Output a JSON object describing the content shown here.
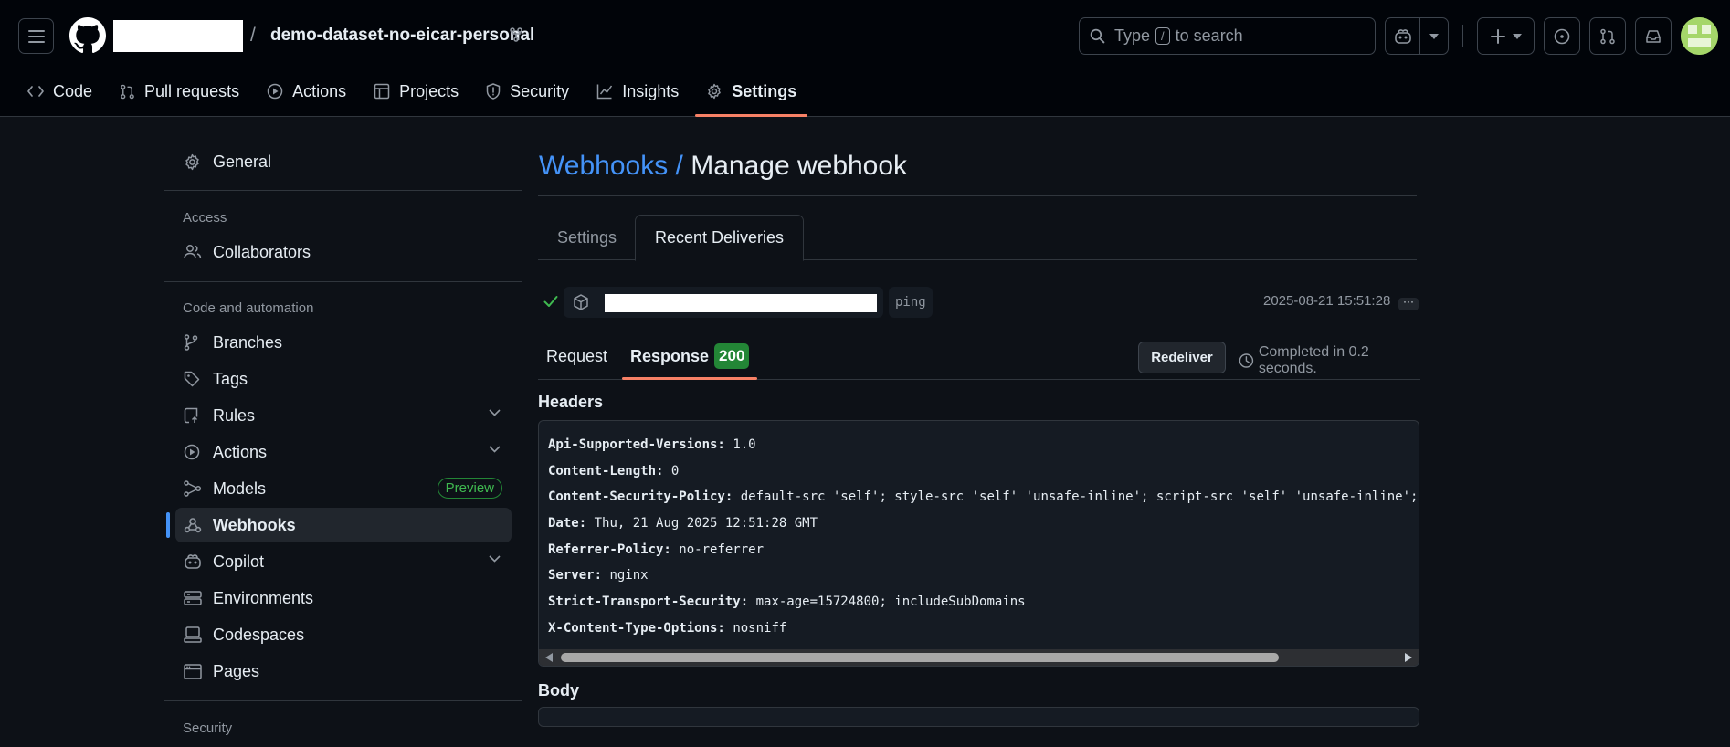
{
  "header": {
    "repo_separator": "/",
    "repo_name": "demo-dataset-no-eicar-personal",
    "search": {
      "prefix": "Type",
      "key": "/",
      "suffix": "to search"
    }
  },
  "repo_nav": [
    {
      "label": "Code",
      "icon": "code-icon"
    },
    {
      "label": "Pull requests",
      "icon": "pull-request-icon"
    },
    {
      "label": "Actions",
      "icon": "play-icon"
    },
    {
      "label": "Projects",
      "icon": "table-icon"
    },
    {
      "label": "Security",
      "icon": "shield-icon"
    },
    {
      "label": "Insights",
      "icon": "graph-icon"
    },
    {
      "label": "Settings",
      "icon": "gear-icon",
      "active": true
    }
  ],
  "sidebar": {
    "general": "General",
    "access_heading": "Access",
    "collaborators": "Collaborators",
    "code_heading": "Code and automation",
    "items": {
      "branches": "Branches",
      "tags": "Tags",
      "rules": "Rules",
      "actions": "Actions",
      "models": "Models",
      "models_badge": "Preview",
      "webhooks": "Webhooks",
      "copilot": "Copilot",
      "environments": "Environments",
      "codespaces": "Codespaces",
      "pages": "Pages"
    },
    "security_heading": "Security"
  },
  "main": {
    "breadcrumb": "Webhooks /",
    "title": "Manage webhook",
    "tabs": {
      "settings": "Settings",
      "recent": "Recent Deliveries"
    },
    "delivery": {
      "event": "ping",
      "time": "2025-08-21 15:51:28",
      "more": "···"
    },
    "subtabs": {
      "request": "Request",
      "response": "Response",
      "status_code": "200"
    },
    "redeliver": "Redeliver",
    "completed": "Completed in 0.2 seconds.",
    "headers_title": "Headers",
    "headers": [
      {
        "k": "Api-Supported-Versions:",
        "v": "1.0"
      },
      {
        "k": "Content-Length:",
        "v": "0"
      },
      {
        "k": "Content-Security-Policy:",
        "v": "default-src 'self'; style-src 'self' 'unsafe-inline'; script-src 'self' 'unsafe-inline'; im"
      },
      {
        "k": "Date:",
        "v": "Thu, 21 Aug 2025 12:51:28 GMT"
      },
      {
        "k": "Referrer-Policy:",
        "v": "no-referrer"
      },
      {
        "k": "Server:",
        "v": "nginx"
      },
      {
        "k": "Strict-Transport-Security:",
        "v": "max-age=15724800; includeSubDomains"
      },
      {
        "k": "X-Content-Type-Options:",
        "v": "nosniff"
      }
    ],
    "body_title": "Body"
  },
  "colors": {
    "accent_link": "#4493f8",
    "tab_underline": "#f78166",
    "success": "#238636",
    "bg": "#0d1117"
  }
}
